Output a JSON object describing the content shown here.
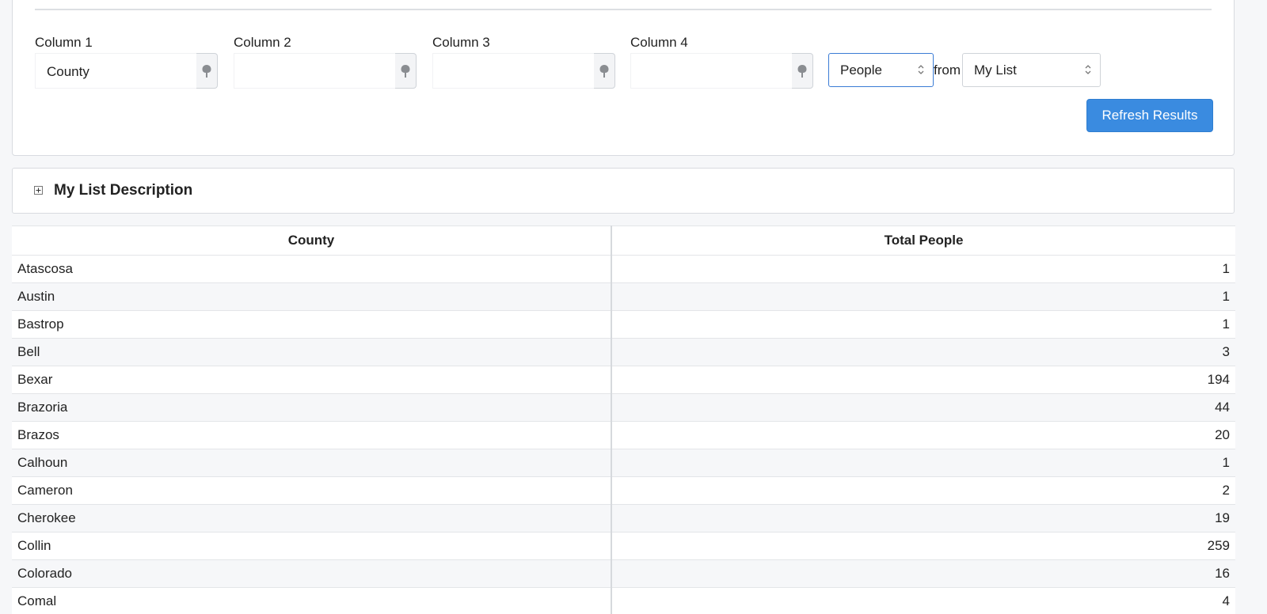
{
  "columns": [
    {
      "label": "Column 1",
      "value": "County"
    },
    {
      "label": "Column 2",
      "value": ""
    },
    {
      "label": "Column 3",
      "value": ""
    },
    {
      "label": "Column 4",
      "value": ""
    }
  ],
  "measure_select": {
    "value": "People"
  },
  "from_label": "from",
  "list_select": {
    "value": "My List"
  },
  "refresh_button": "Refresh Results",
  "description": {
    "title": "My List Description"
  },
  "table": {
    "headers": [
      "County",
      "Total People"
    ],
    "rows": [
      [
        "Atascosa",
        "1"
      ],
      [
        "Austin",
        "1"
      ],
      [
        "Bastrop",
        "1"
      ],
      [
        "Bell",
        "3"
      ],
      [
        "Bexar",
        "194"
      ],
      [
        "Brazoria",
        "44"
      ],
      [
        "Brazos",
        "20"
      ],
      [
        "Calhoun",
        "1"
      ],
      [
        "Cameron",
        "2"
      ],
      [
        "Cherokee",
        "19"
      ],
      [
        "Collin",
        "259"
      ],
      [
        "Colorado",
        "16"
      ],
      [
        "Comal",
        "4"
      ]
    ]
  },
  "colors": {
    "accent": "#3a8be0",
    "focus_border": "#3a7bd5"
  }
}
